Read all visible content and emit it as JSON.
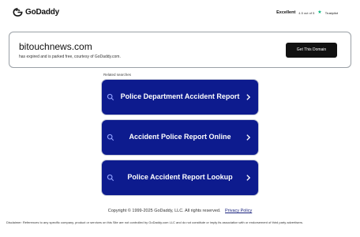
{
  "header": {
    "brand": "GoDaddy",
    "rating_word": "Excellent",
    "rating_score": "4.5 out of 5",
    "trustpilot_label": "Trustpilot"
  },
  "domain": {
    "name": "bitouchnews.com",
    "subtitle": "has expired and is parked free, courtesy of GoDaddy.com.",
    "cta_label": "Get This Domain"
  },
  "related": {
    "label": "Related searches",
    "items": [
      {
        "label": "Police Department Accident Report"
      },
      {
        "label": "Accident Police Report Online"
      },
      {
        "label": "Police Accident Report Lookup"
      }
    ]
  },
  "footer": {
    "copyright": "Copyright © 1999-2025 GoDaddy, LLC. All rights reserved.",
    "privacy_label": "Privacy Policy",
    "disclaimer": "Disclaimer: References to any specific company, product or services on this Site are not controlled by GoDaddy.com LLC and do not constitute or imply its association with or endorsement of third party advertisers."
  },
  "colors": {
    "button_bg": "#0d1b8e",
    "cta_bg": "#111111",
    "trustpilot_green": "#00b67a"
  }
}
